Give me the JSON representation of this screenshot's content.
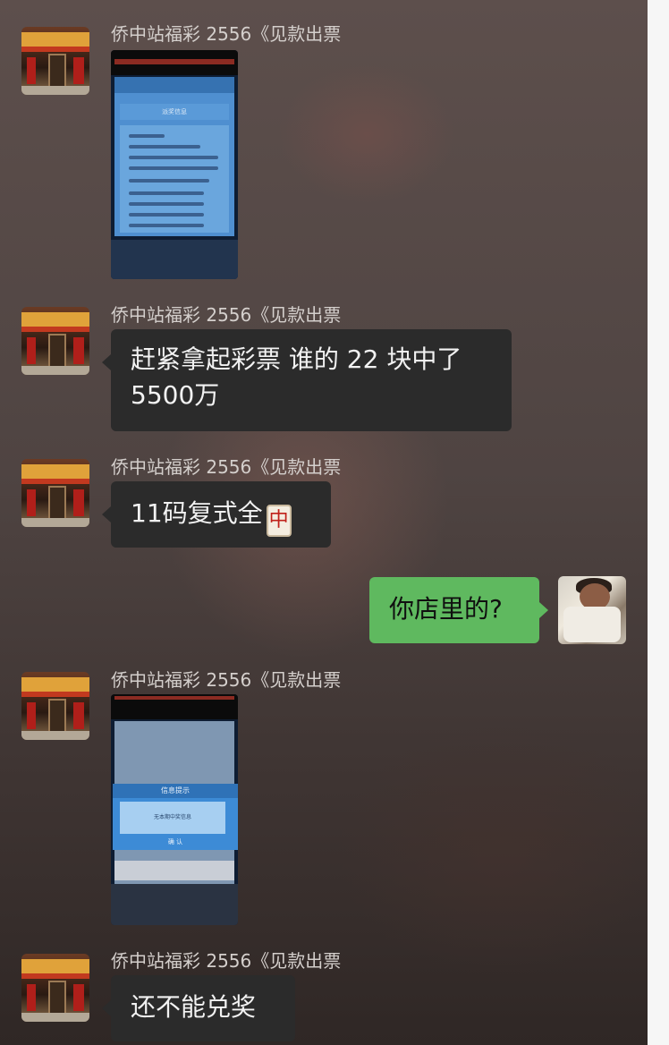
{
  "sender_name": "侨中站福彩 2556《见款出票",
  "messages": [
    {
      "type": "image",
      "sender": "侨中站福彩 2556《见款出票",
      "content": "lottery draw info phone photo",
      "photo_text": {
        "header": "派奖信息"
      }
    },
    {
      "type": "text",
      "sender": "侨中站福彩 2556《见款出票",
      "lines": [
        "赶紧拿起彩票 谁的 22 块中了",
        "5500万"
      ]
    },
    {
      "type": "text",
      "sender": "侨中站福彩 2556《见款出票",
      "text": "11码复式全",
      "emoji": "🀄"
    },
    {
      "type": "text",
      "sender": "self",
      "text": "你店里的?"
    },
    {
      "type": "image",
      "sender": "侨中站福彩 2556《见款出票",
      "content": "phone photo with dialog",
      "photo_text": {
        "dialog_title": "信息提示",
        "dialog_msg": "无本期中奖信息",
        "dialog_ok": "确 认"
      }
    },
    {
      "type": "text",
      "sender": "侨中站福彩 2556《见款出票",
      "text": "还不能兑奖"
    }
  ],
  "icons": {
    "contact_avatar": "lottery-shop-avatar-icon",
    "self_avatar": "user-avatar-icon",
    "mahjong_emoji": "mahjong-red-dragon-icon"
  },
  "colors": {
    "self_bubble": "#5fb95f",
    "other_bubble": "#2b2b2b"
  }
}
